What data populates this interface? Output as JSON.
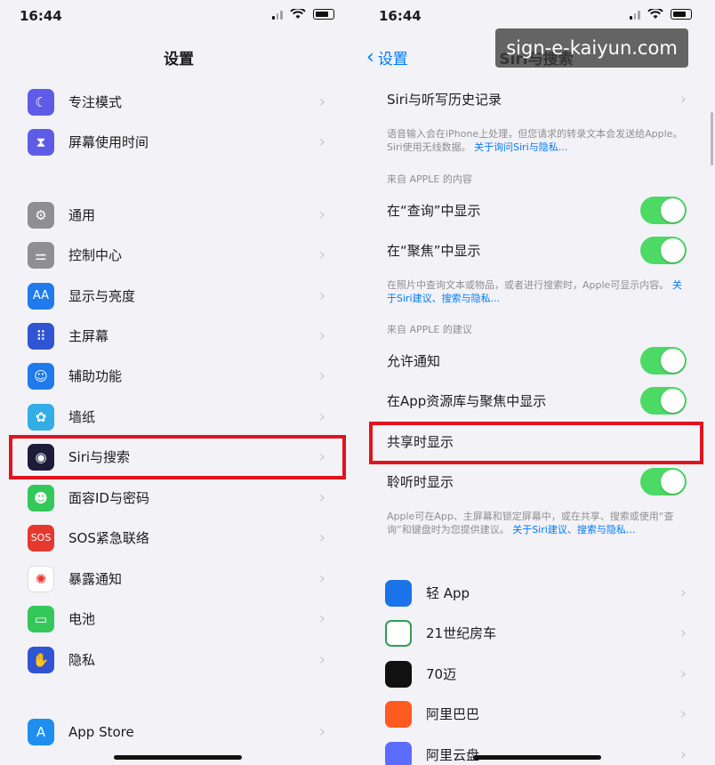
{
  "left": {
    "status_time": "16:44",
    "title": "设置",
    "rows": [
      {
        "label": "专注模式",
        "icon": "moon-icon",
        "color": "#5e5ce6",
        "glyph": "☾"
      },
      {
        "label": "屏幕使用时间",
        "icon": "hourglass-icon",
        "color": "#5e5ce6",
        "glyph": "⧗"
      },
      {
        "label": "通用",
        "icon": "gear-icon",
        "color": "#8e8e93",
        "glyph": "⚙"
      },
      {
        "label": "控制中心",
        "icon": "toggles-icon",
        "color": "#8e8e93",
        "glyph": "⚌"
      },
      {
        "label": "显示与亮度",
        "icon": "text-size-icon",
        "color": "#1f7aeb",
        "glyph": "AA"
      },
      {
        "label": "主屏幕",
        "icon": "home-grid-icon",
        "color": "#2f55d4",
        "glyph": "⠿"
      },
      {
        "label": "辅助功能",
        "icon": "accessibility-icon",
        "color": "#1f7aeb",
        "glyph": "☺"
      },
      {
        "label": "墙纸",
        "icon": "flower-icon",
        "color": "#32ade6",
        "glyph": "✿"
      },
      {
        "label": "Siri与搜索",
        "icon": "siri-icon",
        "color": "#1c1c3a",
        "glyph": "◉"
      },
      {
        "label": "面容ID与密码",
        "icon": "face-id-icon",
        "color": "#34c759",
        "glyph": "☻"
      },
      {
        "label": "SOS紧急联络",
        "icon": "sos-icon",
        "color": "#e5392f",
        "glyph": "SOS"
      },
      {
        "label": "暴露通知",
        "icon": "exposure-icon",
        "color": "#ffffff",
        "glyph": "✺"
      },
      {
        "label": "电池",
        "icon": "battery-icon",
        "color": "#34c759",
        "glyph": "▭"
      },
      {
        "label": "隐私",
        "icon": "hand-icon",
        "color": "#2f55d4",
        "glyph": "✋"
      },
      {
        "label": "App Store",
        "icon": "app-store-icon",
        "color": "#1f8ef1",
        "glyph": "A"
      }
    ]
  },
  "right": {
    "status_time": "16:44",
    "back_label": "设置",
    "title": "Siri与搜索",
    "history_row": "Siri与听写历史记录",
    "note1_text": "语音输入会在iPhone上处理，但您请求的转录文本会发送给Apple。Siri使用无线数据。",
    "note1_link": "关于询问Siri与隐私...",
    "section1": "来自 APPLE 的内容",
    "row_lookup": "在“查询”中显示",
    "row_spotlight": "在“聚焦”中显示",
    "note2_text": "在照片中查询文本或物品，或者进行搜索时，Apple可显示内容。",
    "note2_link": "关于Siri建议、搜索与隐私...",
    "section2": "来自 APPLE 的建议",
    "row_notify": "允许通知",
    "row_library": "在App资源库与聚焦中显示",
    "row_share": "共享时显示",
    "row_listen": "聆听时显示",
    "note3_text": "Apple可在App、主屏幕和锁定屏幕中，或在共享、搜索或使用“查询”和键盘时为您提供建议。",
    "note3_link": "关于Siri建议、搜索与隐私...",
    "apps": [
      {
        "label": "轻 App",
        "icon": "light-app-icon",
        "color": "#1a73e8"
      },
      {
        "label": "21世纪房车",
        "icon": "rv-21-icon",
        "color": "#ffffff"
      },
      {
        "label": "70迈",
        "icon": "70mai-icon",
        "color": "#111111"
      },
      {
        "label": "阿里巴巴",
        "icon": "alibaba-icon",
        "color": "#ff5a1f"
      },
      {
        "label": "阿里云盘",
        "icon": "aliyun-drive-icon",
        "color": "#5b6cff"
      }
    ]
  },
  "watermark": "sign-e-kaiyun.com",
  "colors": {
    "highlight": "#e0141e",
    "toggle_on": "#4cd964",
    "link": "#007aff"
  }
}
